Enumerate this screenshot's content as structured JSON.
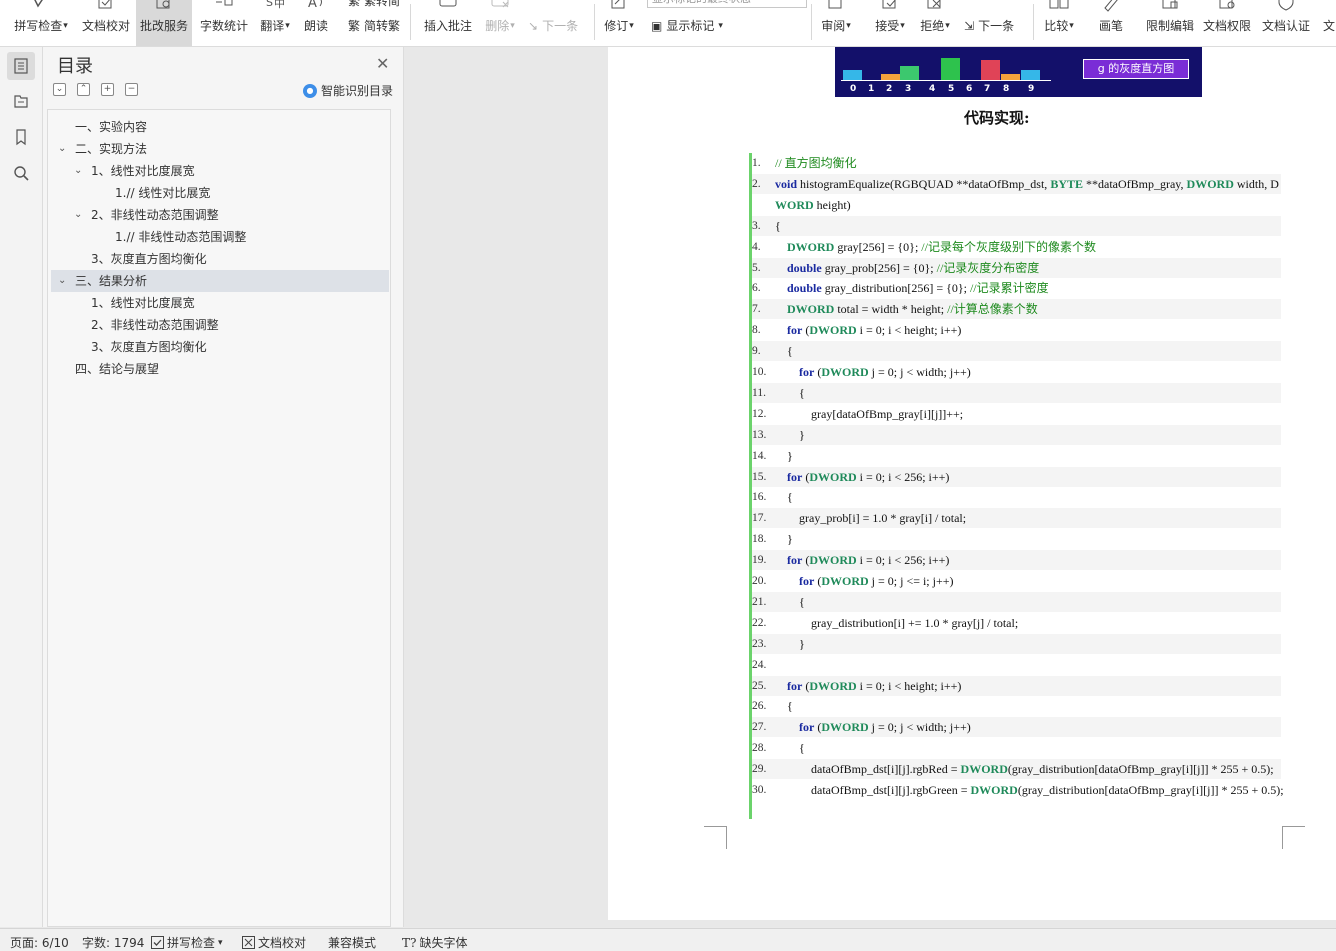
{
  "ribbon": {
    "groups": [
      {
        "id": "spell",
        "label": "拼写检查",
        "dropdown": true,
        "icon": "spellcheck-icon"
      },
      {
        "id": "doccheck",
        "label": "文档校对",
        "icon": "doc-check-icon"
      },
      {
        "id": "revise_service",
        "label": "批改服务",
        "active": true,
        "icon": "revise-service-icon"
      },
      {
        "id": "wordcount",
        "label": "字数统计",
        "icon": "wordcount-icon"
      },
      {
        "id": "translate",
        "label": "翻译",
        "dropdown": true,
        "icon": "translate-icon"
      },
      {
        "id": "read",
        "label": "朗读",
        "icon": "read-aloud-icon"
      },
      {
        "id": "insert_comment",
        "label": "插入批注",
        "icon": "comment-icon"
      },
      {
        "id": "delete",
        "label": "删除",
        "dropdown": true,
        "disabled": true,
        "icon": "delete-comment-icon"
      },
      {
        "id": "track",
        "label": "修订",
        "dropdown": true,
        "icon": "track-changes-icon"
      },
      {
        "id": "review",
        "label": "审阅",
        "dropdown": true,
        "icon": "review-icon"
      },
      {
        "id": "accept",
        "label": "接受",
        "dropdown": true,
        "icon": "accept-icon"
      },
      {
        "id": "reject",
        "label": "拒绝",
        "dropdown": true,
        "icon": "reject-icon"
      },
      {
        "id": "compare",
        "label": "比较",
        "dropdown": true,
        "icon": "compare-icon"
      },
      {
        "id": "pen",
        "label": "画笔",
        "icon": "pen-icon"
      },
      {
        "id": "restrict",
        "label": "限制编辑",
        "icon": "restrict-edit-icon"
      },
      {
        "id": "permission",
        "label": "文档权限",
        "icon": "doc-permission-icon"
      },
      {
        "id": "certify",
        "label": "文档认证",
        "icon": "doc-certify-icon"
      },
      {
        "id": "more",
        "label": "文"
      }
    ],
    "small": {
      "simp_trad": "繁转简",
      "trad_simp": "简转繁",
      "next_comment": "下一条",
      "show_marks": "显示标记",
      "next_change": "下一条"
    },
    "combo_value": "显示标记的最终状态"
  },
  "toc": {
    "title": "目录",
    "smart_label": "智能识别目录",
    "items": [
      {
        "text": "一、实验内容",
        "level": 1,
        "expandable": false
      },
      {
        "text": "二、实现方法",
        "level": 1,
        "expandable": true
      },
      {
        "text": "1、线性对比度展宽",
        "level": 2,
        "expandable": true
      },
      {
        "text": "1.// 线性对比展宽",
        "level": 3,
        "expandable": false
      },
      {
        "text": "2、非线性动态范围调整",
        "level": 2,
        "expandable": true
      },
      {
        "text": "1.// 非线性动态范围调整",
        "level": 3,
        "expandable": false
      },
      {
        "text": "3、灰度直方图均衡化",
        "level": 2,
        "expandable": false
      },
      {
        "text": "三、结果分析",
        "level": 1,
        "expandable": true,
        "selected": true
      },
      {
        "text": "1、线性对比度展宽",
        "level": 2,
        "expandable": false
      },
      {
        "text": "2、非线性动态范围调整",
        "level": 2,
        "expandable": false
      },
      {
        "text": "3、灰度直方图均衡化",
        "level": 2,
        "expandable": false
      },
      {
        "text": "四、结论与展望",
        "level": 1,
        "expandable": false
      }
    ]
  },
  "document": {
    "histogram_axis": [
      "0",
      "1",
      "2",
      "3",
      "4",
      "5",
      "6",
      "7",
      "8",
      "9"
    ],
    "histogram_label": "g 的灰度直方图",
    "code_heading": "代码实现:",
    "code_lines": [
      "// 直方图均衡化",
      "void histogramEqualize(RGBQUAD **dataOfBmp_dst, BYTE **dataOfBmp_gray, DWORD width, D",
      "WORD height)",
      "{",
      "    DWORD gray[256] = {0};              //记录每个灰度级别下的像素个数",
      "    double gray_prob[256] = {0};        //记录灰度分布密度",
      "    double gray_distribution[256] = {0}; //记录累计密度",
      "    DWORD total = width * height;       //计算总像素个数",
      "    for (DWORD i = 0; i < height; i++)",
      "    {",
      "        for (DWORD j = 0; j < width; j++)",
      "        {",
      "            gray[dataOfBmp_gray[i][j]]++;",
      "        }",
      "    }",
      "    for (DWORD i = 0; i < 256; i++)",
      "    {",
      "        gray_prob[i] = 1.0 * gray[i] / total;",
      "    }",
      "    for (DWORD i = 0; i < 256; i++)",
      "        for (DWORD j = 0; j <= i; j++)",
      "        {",
      "            gray_distribution[i] += 1.0 * gray[j] / total;",
      "        }",
      "",
      "    for (DWORD i = 0; i < height; i++)",
      "    {",
      "        for (DWORD j = 0; j < width; j++)",
      "        {",
      "            dataOfBmp_dst[i][j].rgbRed = DWORD(gray_distribution[dataOfBmp_gray[i][j]] * 255 + 0.5);",
      "            dataOfBmp_dst[i][j].rgbGreen = DWORD(gray_distribution[dataOfBmp_gray[i][j]] * 255 + 0.5);"
    ],
    "line_numbers": [
      "1.",
      "2.",
      "",
      "3.",
      "4.",
      "5.",
      "6.",
      "7.",
      "8.",
      "9.",
      "10.",
      "11.",
      "12.",
      "13.",
      "14.",
      "15.",
      "16.",
      "17.",
      "18.",
      "19.",
      "20.",
      "21.",
      "22.",
      "23.",
      "24.",
      "25.",
      "26.",
      "27.",
      "28.",
      "29.",
      "30."
    ]
  },
  "status": {
    "page": "页面: 6/10",
    "words": "字数: 1794",
    "spell": "拼写检查",
    "doccheck": "文档校对",
    "compat": "兼容模式",
    "missing_font": "缺失字体"
  },
  "colors": {
    "accent_green": "#6bd36b",
    "histogram_bg": "#13106a",
    "keyword": "#1a2aa0",
    "comment": "#1e8a1e"
  }
}
